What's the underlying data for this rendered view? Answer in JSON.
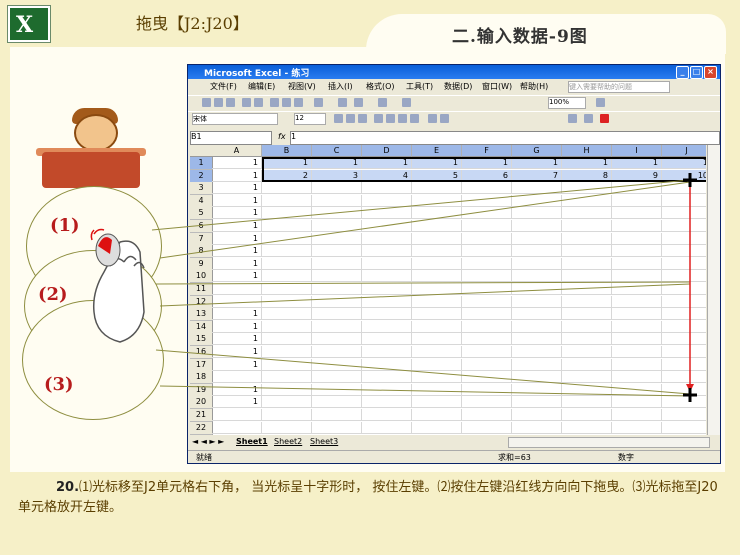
{
  "header": {
    "logo_letter": "X",
    "left_title": "拖曳【J2:J20】",
    "right_title": "二.输入数据-9图"
  },
  "callouts": [
    "(1)",
    "(2)",
    "(3)"
  ],
  "excel": {
    "title": "Microsoft Excel - 练习",
    "menu": [
      "文件(F)",
      "编辑(E)",
      "视图(V)",
      "插入(I)",
      "格式(O)",
      "工具(T)",
      "数据(D)",
      "窗口(W)",
      "帮助(H)"
    ],
    "help_placeholder": "键入需要帮助的问题",
    "zoom": "100%",
    "font_name": "宋体",
    "font_size": "12",
    "namebox": "B1",
    "fx": "fx",
    "formula": "1",
    "columns": [
      "A",
      "B",
      "C",
      "D",
      "E",
      "F",
      "G",
      "H",
      "I",
      "J"
    ],
    "row1": [
      "1",
      "1",
      "1",
      "1",
      "1",
      "1",
      "1",
      "1",
      "1",
      "1"
    ],
    "row2": [
      "1",
      "2",
      "3",
      "4",
      "5",
      "6",
      "7",
      "8",
      "9",
      "10"
    ],
    "colA_value": "1",
    "rows_visible": [
      "1",
      "2",
      "3",
      "4",
      "5",
      "6",
      "7",
      "8",
      "9",
      "10",
      "11",
      "12",
      "13",
      "14",
      "15",
      "16",
      "17",
      "18",
      "19",
      "20",
      "21",
      "22"
    ],
    "sheet_tabs": [
      "Sheet1",
      "Sheet2",
      "Sheet3"
    ],
    "status_ready": "就绪",
    "status_sum": "求和=63",
    "status_num": "数字"
  },
  "caption": {
    "number": "20.",
    "text": "⑴光标移至J2单元格右下角， 当光标呈十字形时， 按住左键。⑵按住左键沿红线方向向下拖曳。⑶光标拖至J20单元格放开左键。"
  },
  "colors": {
    "background": "#f6f0c8",
    "panel": "#fffdf2",
    "red_line": "#e02020",
    "selection": "#c8d8f4"
  }
}
